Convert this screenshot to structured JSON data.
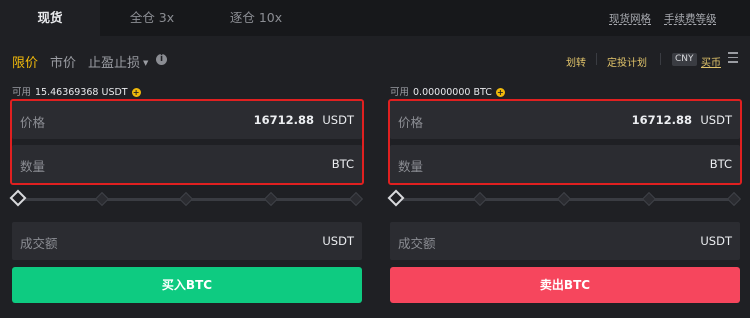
{
  "tabs": [
    {
      "label": "现货",
      "active": true
    },
    {
      "label": "全仓 3x",
      "active": false
    },
    {
      "label": "逐仓 10x",
      "active": false
    }
  ],
  "top_links": {
    "grid": "现货网格",
    "fees": "手续费等级"
  },
  "order_types": [
    {
      "label": "限价",
      "active": true
    },
    {
      "label": "市价",
      "active": false
    },
    {
      "label": "止盈止损",
      "active": false
    }
  ],
  "right_links": {
    "transfer": "划转",
    "plan": "定投计划",
    "cny": "CNY",
    "buy_coin": "买币"
  },
  "buy_panel": {
    "available_label": "可用",
    "available_value": "15.46369368 USDT",
    "price_label": "价格",
    "price_value": "16712.88",
    "price_unit": "USDT",
    "amount_label": "数量",
    "amount_unit": "BTC",
    "total_label": "成交额",
    "total_unit": "USDT",
    "button_label": "买入BTC",
    "slider_percent": 0
  },
  "sell_panel": {
    "available_label": "可用",
    "available_value": "0.00000000 BTC",
    "price_label": "价格",
    "price_value": "16712.88",
    "price_unit": "USDT",
    "amount_label": "数量",
    "amount_unit": "BTC",
    "total_label": "成交额",
    "total_unit": "USDT",
    "button_label": "卖出BTC",
    "slider_percent": 0
  },
  "colors": {
    "accent": "#f0b90b",
    "buy": "#0ecb81",
    "sell": "#f6465d",
    "highlight_box": "#e02020"
  }
}
